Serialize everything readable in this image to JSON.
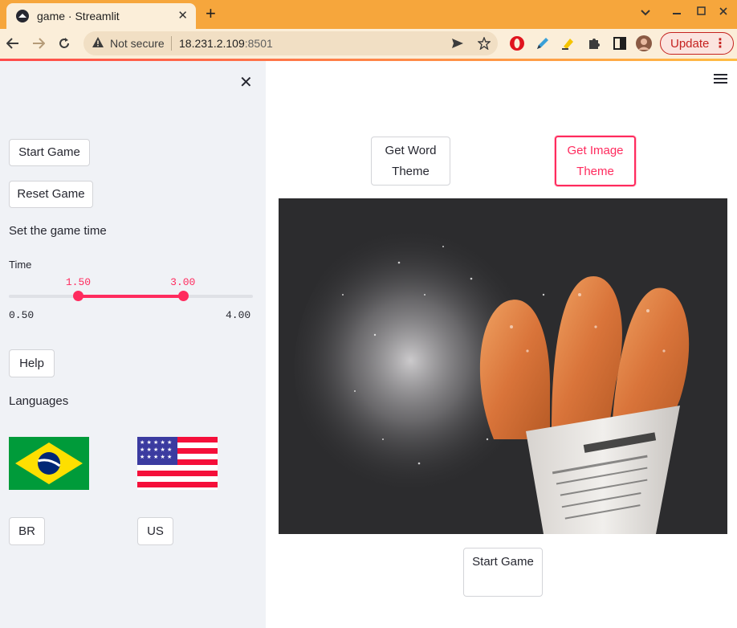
{
  "browser": {
    "tab_title": "game · Streamlit",
    "close_tab": "✕",
    "new_tab": "+",
    "security_label": "Not secure",
    "url_host": "18.231.2.109",
    "url_port": ":8501",
    "update_label": "Update"
  },
  "sidebar": {
    "close": "✕",
    "start_game_label": "Start Game",
    "reset_game_label": "Reset Game",
    "game_time_heading": "Set the game time",
    "slider": {
      "label": "Time",
      "min": 0.5,
      "max": 4.0,
      "low": 1.5,
      "high": 3.0,
      "low_text": "1.50",
      "high_text": "3.00",
      "min_text": "0.50",
      "max_text": "4.00",
      "color": "#ff2b5e"
    },
    "help_label": "Help",
    "languages_heading": "Languages",
    "languages": [
      {
        "flag": "brazil-flag",
        "label": "BR"
      },
      {
        "flag": "us-flag",
        "label": "US"
      }
    ]
  },
  "main": {
    "word_theme_label": "Get Word Theme",
    "image_theme_label": "Get Image Theme",
    "start_game_label": "Start Game",
    "image_subject": "churros-in-newspaper-cone"
  },
  "colors": {
    "accent": "#ff2b5e",
    "sidebar_bg": "#f0f2f6",
    "chrome": "#f6a63c"
  }
}
